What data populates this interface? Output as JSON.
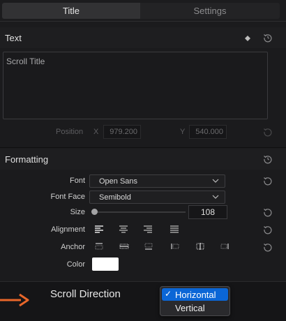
{
  "tabs": {
    "title": "Title",
    "settings": "Settings"
  },
  "text_section": {
    "heading": "Text",
    "content": "Scroll Title",
    "position_label": "Position",
    "x_label": "X",
    "x_value": "979.200",
    "y_label": "Y",
    "y_value": "540.000"
  },
  "formatting": {
    "heading": "Formatting",
    "font_label": "Font",
    "font_value": "Open Sans",
    "face_label": "Font Face",
    "face_value": "Semibold",
    "size_label": "Size",
    "size_value": "108",
    "size_slider_fraction": 0.0,
    "alignment_label": "Alignment",
    "anchor_label": "Anchor",
    "color_label": "Color",
    "color_value": "#ffffff"
  },
  "scroll": {
    "label": "Scroll Direction",
    "options": [
      "Horizontal",
      "Vertical"
    ],
    "selected": "Horizontal",
    "check": "✓"
  },
  "colors": {
    "accent": "#0b66d6",
    "arrow": "#e8662a"
  }
}
